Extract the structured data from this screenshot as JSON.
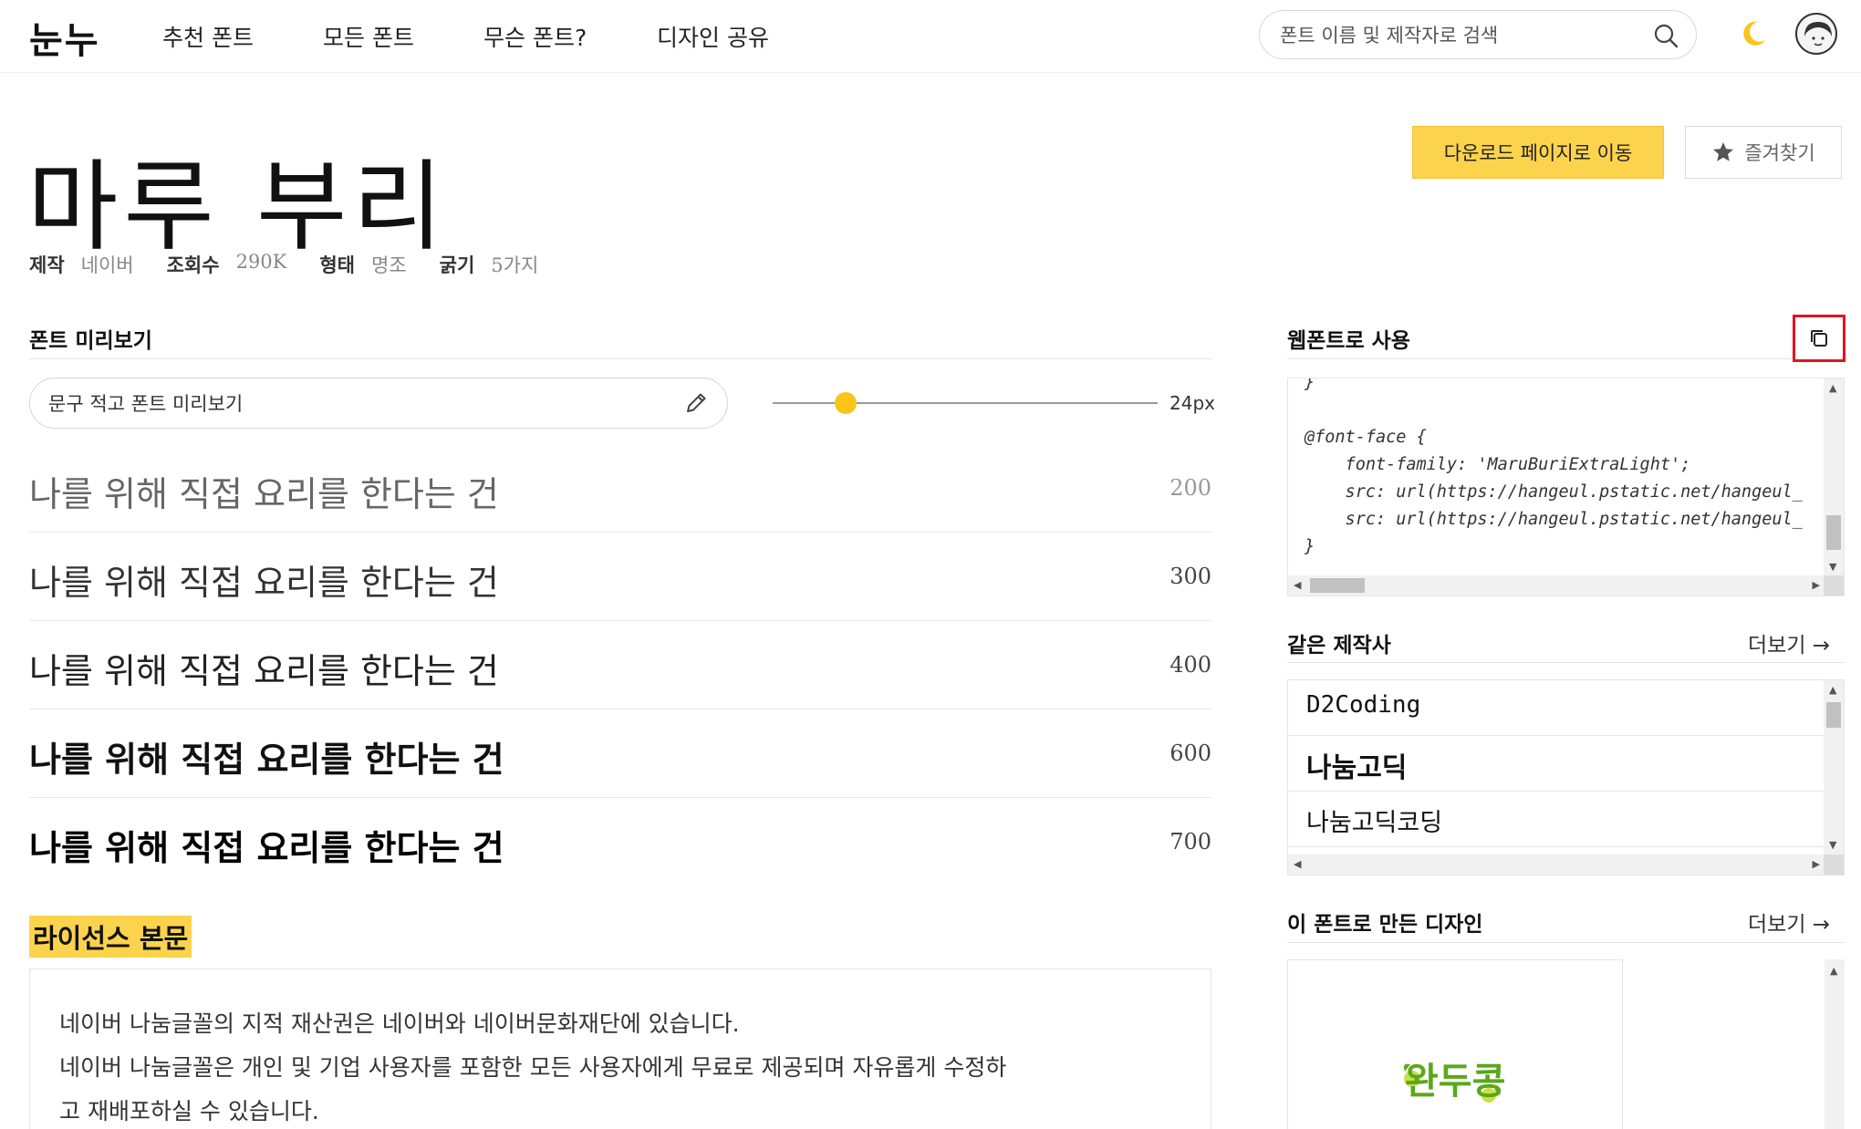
{
  "header": {
    "logo": "눈누",
    "nav": [
      "추천 폰트",
      "모든 폰트",
      "무슨 폰트?",
      "디자인 공유"
    ],
    "search_placeholder": "폰트 이름 및 제작자로 검색"
  },
  "font": {
    "title": "마루 부리",
    "meta": [
      {
        "key": "제작",
        "value": "네이버"
      },
      {
        "key": "조회수",
        "value": "290K"
      },
      {
        "key": "형태",
        "value": "명조"
      },
      {
        "key": "굵기",
        "value": "5가지"
      }
    ],
    "download_label": "다운로드 페이지로 이동",
    "favorite_label": "즐겨찾기"
  },
  "preview": {
    "heading": "폰트 미리보기",
    "input_placeholder": "문구 적고 폰트 미리보기",
    "size_label": "24px",
    "size_fraction": 0.19,
    "rows": [
      {
        "text": "나를 위해 직접 요리를 한다는 건",
        "weight": "200"
      },
      {
        "text": "나를 위해 직접 요리를 한다는 건",
        "weight": "300"
      },
      {
        "text": "나를 위해 직접 요리를 한다는 건",
        "weight": "400"
      },
      {
        "text": "나를 위해 직접 요리를 한다는 건",
        "weight": "600"
      },
      {
        "text": "나를 위해 직접 요리를 한다는 건",
        "weight": "700"
      }
    ]
  },
  "license": {
    "heading": "라이선스 본문",
    "lines": [
      "네이버 나눔글꼴의 지적 재산권은 네이버와 네이버문화재단에 있습니다.",
      "네이버 나눔글꼴은 개인 및 기업 사용자를 포함한 모든 사용자에게 무료로 제공되며 자유롭게 수정하",
      "고 재배포하실 수 있습니다."
    ]
  },
  "webfont": {
    "heading": "웹폰트로 사용",
    "code": "}\n\n@font-face {\n    font-family: 'MaruBuriExtraLight';\n    src: url(https://hangeul.pstatic.net/hangeul_\n    src: url(https://hangeul.pstatic.net/hangeul_\n}"
  },
  "same_maker": {
    "heading": "같은 제작사",
    "more": "더보기 →",
    "items": [
      "D2Coding",
      "나눔고딕",
      "나눔고딕코딩"
    ]
  },
  "designs": {
    "heading": "이 폰트로 만든 디자인",
    "more": "더보기 →",
    "sample_text": "완두콩"
  },
  "colors": {
    "accent": "#fcd34d",
    "highlight_border": "#e0141e"
  }
}
